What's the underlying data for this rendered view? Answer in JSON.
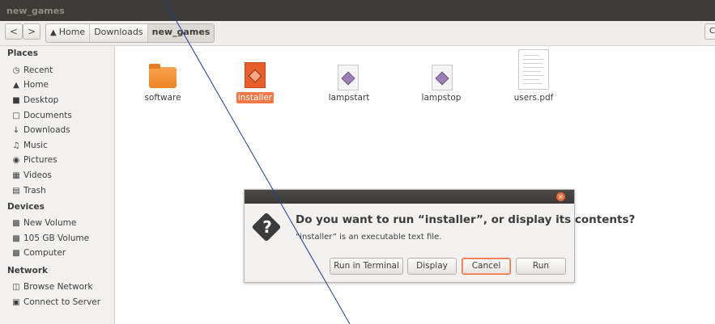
{
  "window": {
    "title": "new_games"
  },
  "toolbar": {
    "back_glyph": "<",
    "forward_glyph": ">",
    "breadcrumbs": [
      "Home",
      "Downloads",
      "new_games"
    ],
    "right_partial": "C"
  },
  "sidebar": {
    "places_label": "Places",
    "places": [
      {
        "label": "Recent",
        "icon": "clock-icon"
      },
      {
        "label": "Home",
        "icon": "home-icon"
      },
      {
        "label": "Desktop",
        "icon": "folder-icon"
      },
      {
        "label": "Documents",
        "icon": "document-icon"
      },
      {
        "label": "Downloads",
        "icon": "download-icon"
      },
      {
        "label": "Music",
        "icon": "music-icon"
      },
      {
        "label": "Pictures",
        "icon": "camera-icon"
      },
      {
        "label": "Videos",
        "icon": "film-icon"
      },
      {
        "label": "Trash",
        "icon": "trash-icon"
      }
    ],
    "devices_label": "Devices",
    "devices": [
      {
        "label": "New Volume",
        "icon": "drive-icon"
      },
      {
        "label": "105 GB Volume",
        "icon": "drive-icon"
      },
      {
        "label": "Computer",
        "icon": "drive-icon"
      }
    ],
    "network_label": "Network",
    "network": [
      {
        "label": "Browse Network",
        "icon": "network-icon"
      },
      {
        "label": "Connect to Server",
        "icon": "server-icon"
      }
    ]
  },
  "files": [
    {
      "name": "software",
      "type": "folder"
    },
    {
      "name": "installer",
      "type": "script",
      "selected": true
    },
    {
      "name": "lampstart",
      "type": "script"
    },
    {
      "name": "lampstop",
      "type": "script"
    },
    {
      "name": "users.pdf",
      "type": "pdf"
    }
  ],
  "dialog": {
    "close_glyph": "×",
    "question": "Do you want to run “installer”, or display its contents?",
    "detail": "“installer” is an executable text file.",
    "buttons": {
      "run_in_terminal": "Run in Terminal",
      "display": "Display",
      "cancel": "Cancel",
      "run": "Run"
    }
  },
  "colors": {
    "accent": "#f07746",
    "titlebar": "#3c3b37",
    "sidebar": "#f2f1f0"
  }
}
